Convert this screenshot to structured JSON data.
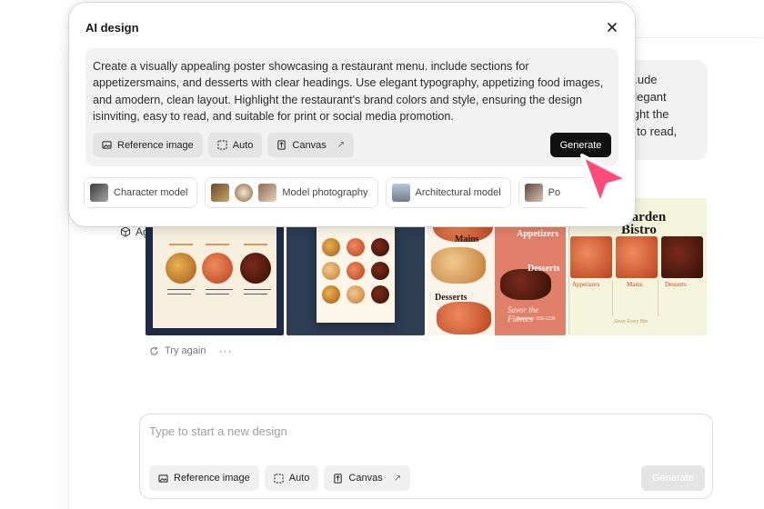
{
  "dialog": {
    "title": "AI design",
    "prompt": "Create a visually appealing poster showcasing a restaurant menu. include sections for appetizersmains, and desserts with clear headings. Use elegant typography, appetizing food images, and amodern, clean layout. Highlight the restaurant's brand colors and style, ensuring the design isinviting, easy to read, and suitable for print or social media promotion.",
    "tools": {
      "reference": "Reference image",
      "auto": "Auto",
      "canvas": "Canvas"
    },
    "generate": "Generate",
    "models": [
      "Character model",
      "Model photography",
      "Architectural model",
      "Po"
    ]
  },
  "background": {
    "prompt_lines": [
      "...ude",
      "elegant",
      "light the",
      "y to read,"
    ],
    "agent_mode": "Agent mode",
    "try_again": "Try again",
    "more": "···",
    "thumbnails": {
      "t3": {
        "appetizers": "Appetizers",
        "mains": "Mains",
        "desserts_right": "Desserts",
        "desserts_left": "Desserts",
        "script": "Savor the Flavors",
        "small": "Reserve: 555-1234"
      },
      "t4": {
        "title_l1": "Garden",
        "title_l2": "Bistro",
        "cap1": "Appetizers",
        "cap2": "Mains",
        "cap3": "Desserts",
        "foot": "Savor Every Bite"
      }
    }
  },
  "composer": {
    "placeholder": "Type to start a new design",
    "tools": {
      "reference": "Reference image",
      "auto": "Auto",
      "canvas": "Canvas"
    },
    "generate": "Generate"
  },
  "colors": {
    "accent_cursor": "#ff4d78",
    "generate_bg": "#111111",
    "disabled_bg": "#e4e4e4"
  }
}
